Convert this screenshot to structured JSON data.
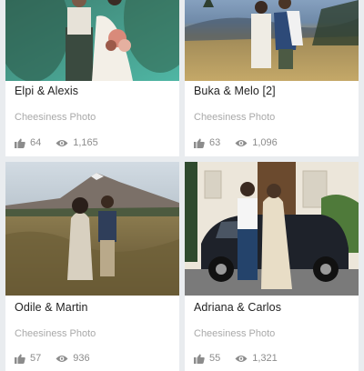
{
  "cards": [
    {
      "title": "Elpi & Alexis",
      "photographer": "Cheesiness Photo",
      "likes": "64",
      "views": "1,165",
      "thumb_colors": [
        "#2e6b5e",
        "#4fb6a4"
      ]
    },
    {
      "title": "Buka & Melo [2]",
      "photographer": "Cheesiness Photo",
      "likes": "63",
      "views": "1,096",
      "thumb_colors": [
        "#5d7da8",
        "#b59a5c"
      ]
    },
    {
      "title": "Odile & Martin",
      "photographer": "Cheesiness Photo",
      "likes": "57",
      "views": "936",
      "thumb_colors": [
        "#b9c7d3",
        "#7c6a3f"
      ]
    },
    {
      "title": "Adriana & Carlos",
      "photographer": "Cheesiness Photo",
      "likes": "55",
      "views": "1,321",
      "thumb_colors": [
        "#efe8dc",
        "#2a2e36"
      ]
    }
  ],
  "icons": {
    "like": "thumbs-up-icon",
    "views": "eye-icon"
  },
  "colors": {
    "background": "#e9ecef",
    "card": "#ffffff",
    "title": "#222222",
    "photographer": "#a9a9a9",
    "stats": "#8c8c8c"
  }
}
